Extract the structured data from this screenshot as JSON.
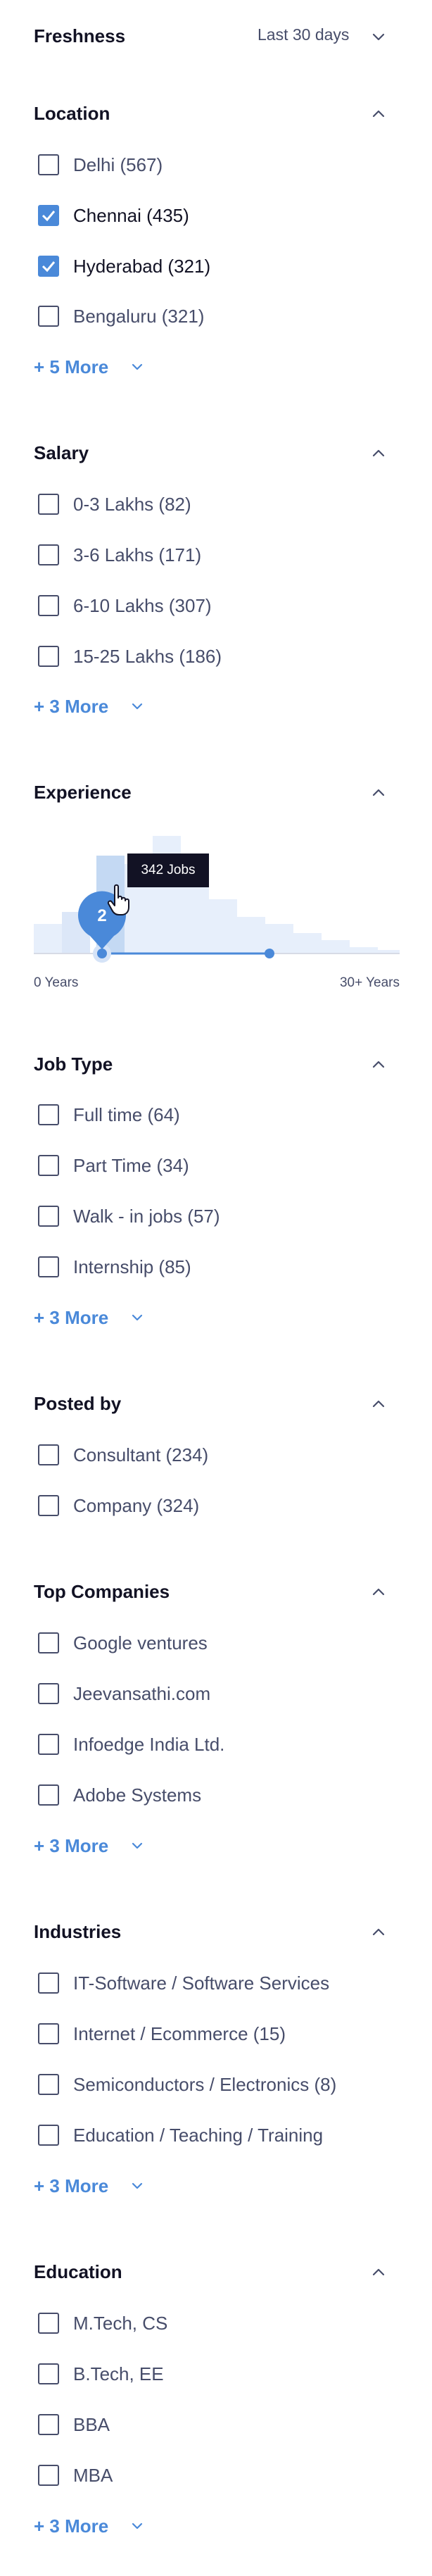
{
  "freshness": {
    "title": "Freshness",
    "value": "Last 30 days"
  },
  "location": {
    "title": "Location",
    "options": [
      {
        "label": "Delhi (567)",
        "checked": false
      },
      {
        "label": "Chennai (435)",
        "checked": true
      },
      {
        "label": "Hyderabad (321)",
        "checked": true
      },
      {
        "label": "Bengaluru (321)",
        "checked": false
      }
    ],
    "more": "+ 5 More"
  },
  "salary": {
    "title": "Salary",
    "options": [
      {
        "label": "0-3 Lakhs (82)",
        "checked": false
      },
      {
        "label": "3-6 Lakhs (171)",
        "checked": false
      },
      {
        "label": "6-10 Lakhs (307)",
        "checked": false
      },
      {
        "label": "15-25 Lakhs (186)",
        "checked": false
      }
    ],
    "more": "+ 3 More"
  },
  "experience": {
    "title": "Experience",
    "tooltip": "342 Jobs",
    "slider_value": "2",
    "min_label": "0 Years",
    "max_label": "30+ Years"
  },
  "job_type": {
    "title": "Job Type",
    "options": [
      {
        "label": "Full time (64)",
        "checked": false
      },
      {
        "label": "Part Time (34)",
        "checked": false
      },
      {
        "label": "Walk - in jobs (57)",
        "checked": false
      },
      {
        "label": "Internship (85)",
        "checked": false
      }
    ],
    "more": "+ 3 More"
  },
  "posted_by": {
    "title": "Posted by",
    "options": [
      {
        "label": "Consultant (234)",
        "checked": false
      },
      {
        "label": "Company (324)",
        "checked": false
      }
    ]
  },
  "top_companies": {
    "title": "Top Companies",
    "options": [
      {
        "label": "Google ventures",
        "checked": false
      },
      {
        "label": "Jeevansathi.com",
        "checked": false
      },
      {
        "label": "Infoedge India Ltd.",
        "checked": false
      },
      {
        "label": "Adobe Systems",
        "checked": false
      }
    ],
    "more": "+ 3 More"
  },
  "industries": {
    "title": "Industries",
    "options": [
      {
        "label": "IT-Software / Software Services",
        "checked": false
      },
      {
        "label": "Internet / Ecommerce (15)",
        "checked": false
      },
      {
        "label": "Semiconductors / Electronics (8)",
        "checked": false
      },
      {
        "label": "Education / Teaching / Training",
        "checked": false
      }
    ],
    "more": "+ 3 More"
  },
  "education": {
    "title": "Education",
    "options": [
      {
        "label": "M.Tech, CS",
        "checked": false
      },
      {
        "label": "B.Tech, EE",
        "checked": false
      },
      {
        "label": "BBA",
        "checked": false
      },
      {
        "label": "MBA",
        "checked": false
      }
    ],
    "more": "+ 3 More"
  },
  "colors": {
    "accent": "#4a89d9",
    "text_dark": "#121224",
    "text_muted": "#474d6a",
    "histogram": "#e7effb"
  }
}
